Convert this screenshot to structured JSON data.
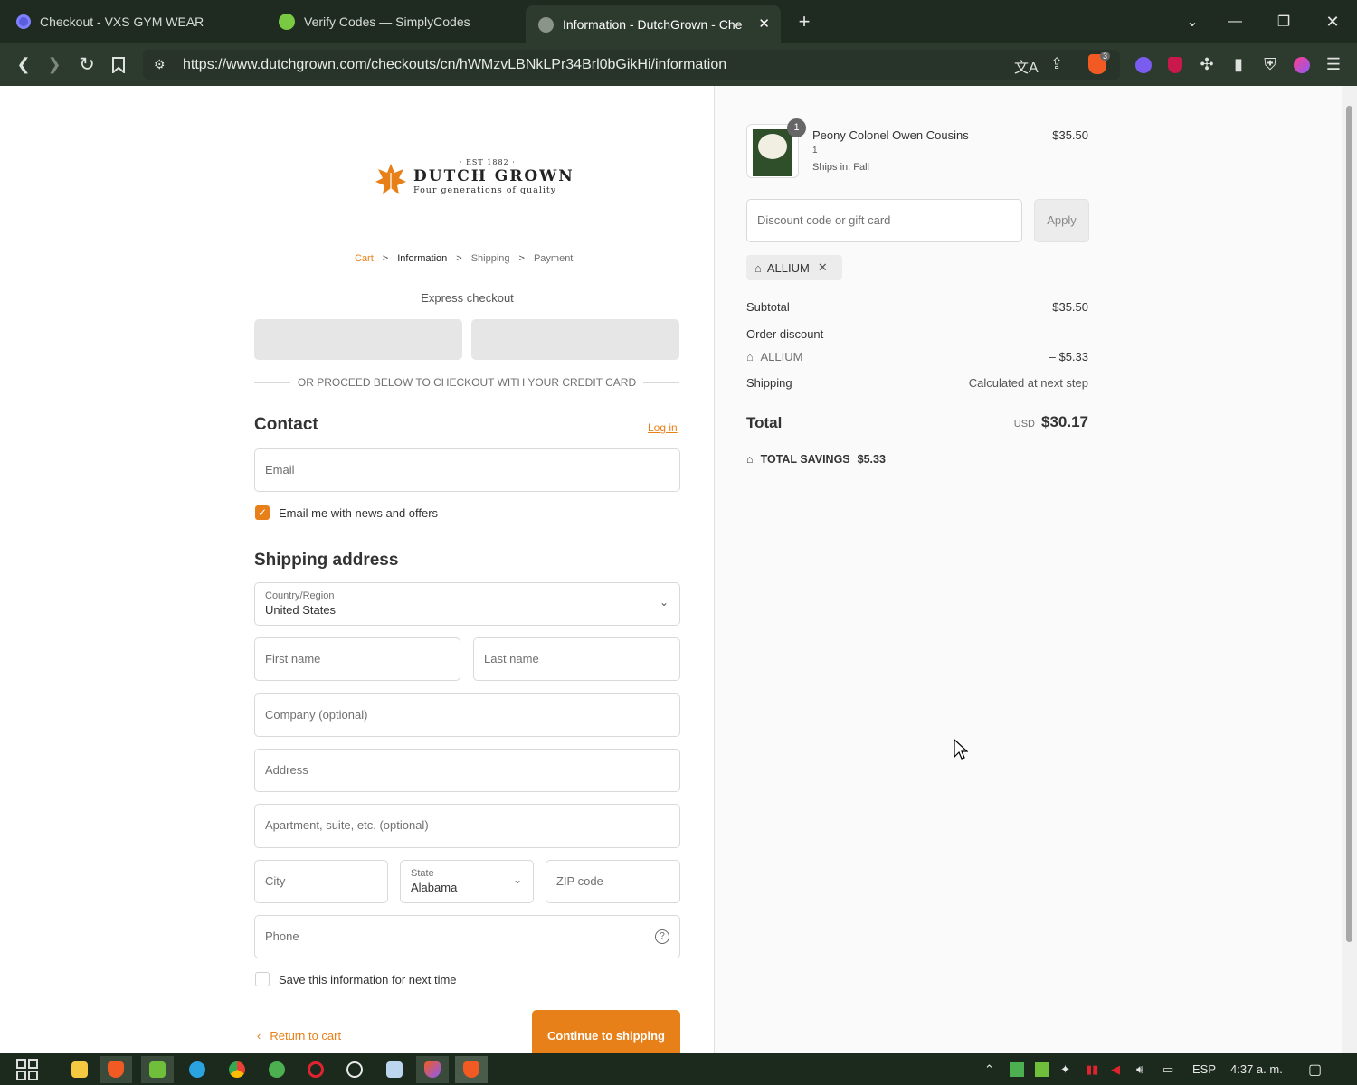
{
  "browser": {
    "tabs": [
      {
        "title": "Checkout - VXS GYM WEAR",
        "active": false
      },
      {
        "title": "Verify Codes — SimplyCodes",
        "active": false
      },
      {
        "title": "Information - DutchGrown - Che",
        "active": true
      }
    ],
    "new_tab": "+",
    "url": "https://www.dutchgrown.com/checkouts/cn/hWMzvLBNkLPr34Brl0bGikHi/information",
    "shield_count": "3"
  },
  "brand": {
    "est": "· EST 1882 ·",
    "name": "DUTCH GROWN",
    "tagline": "Four generations of quality"
  },
  "breadcrumb": {
    "cart": "Cart",
    "information": "Information",
    "shipping": "Shipping",
    "payment": "Payment",
    "sep": ">"
  },
  "express": {
    "title": "Express checkout",
    "divider": "OR PROCEED BELOW TO CHECKOUT WITH YOUR CREDIT CARD"
  },
  "contact": {
    "heading": "Contact",
    "login": "Log in",
    "email_placeholder": "Email",
    "news_label": "Email me with news and offers",
    "news_checked": true
  },
  "shipping": {
    "heading": "Shipping address",
    "country_label": "Country/Region",
    "country_value": "United States",
    "first_name": "First name",
    "last_name": "Last name",
    "company": "Company (optional)",
    "address": "Address",
    "apartment": "Apartment, suite, etc. (optional)",
    "city": "City",
    "state_label": "State",
    "state_value": "Alabama",
    "zip": "ZIP code",
    "phone": "Phone",
    "save_label": "Save this information for next time",
    "save_checked": false
  },
  "actions": {
    "return": "Return to cart",
    "continue": "Continue to shipping"
  },
  "order": {
    "product": {
      "name": "Peony Colonel Owen Cousins",
      "qty_text": "1",
      "ships": "Ships in: Fall",
      "price": "$35.50",
      "badge": "1"
    },
    "discount_placeholder": "Discount code or gift card",
    "apply": "Apply",
    "applied_code": "ALLIUM",
    "subtotal_label": "Subtotal",
    "subtotal": "$35.50",
    "order_discount_label": "Order discount",
    "discount_code": "ALLIUM",
    "discount_amount": "– $5.33",
    "shipping_label": "Shipping",
    "shipping_value": "Calculated at next step",
    "total_label": "Total",
    "currency": "USD",
    "total": "$30.17",
    "savings_label": "TOTAL SAVINGS",
    "savings": "$5.33"
  },
  "taskbar": {
    "lang": "ESP",
    "time": "4:37 a. m."
  },
  "colors": {
    "accent": "#e8801a",
    "chrome_dark": "#1f2b21",
    "chrome_toolbar": "#2d3a2e",
    "taskbar": "#1c2a1e"
  }
}
